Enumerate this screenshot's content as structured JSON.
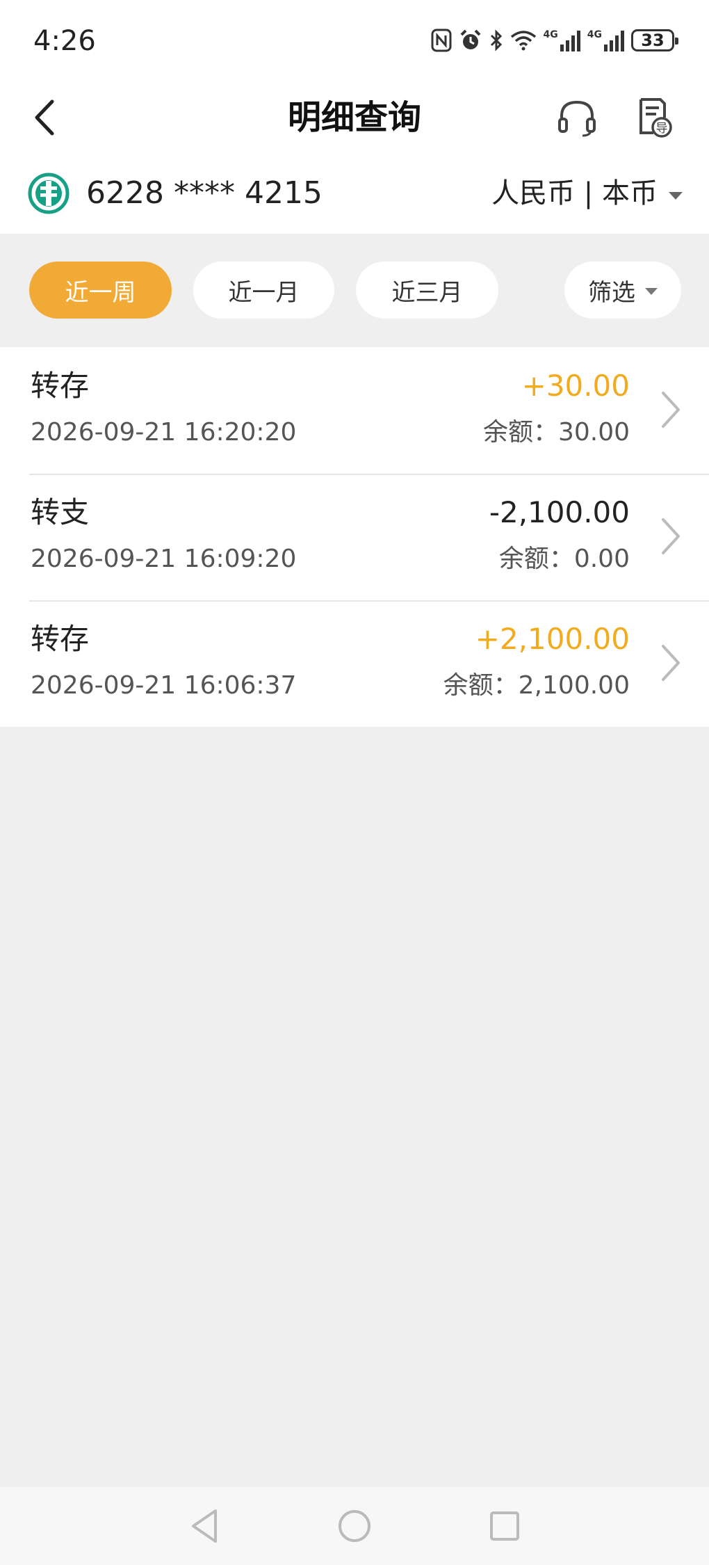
{
  "status_bar": {
    "time": "4:26",
    "signal_label_1": "4G",
    "signal_label_2": "4G",
    "battery": "33",
    "icons": [
      "nfc-icon",
      "alarm-icon",
      "bluetooth-icon",
      "wifi-icon",
      "signal-4g-icon",
      "signal-4g-icon",
      "battery-icon"
    ]
  },
  "header": {
    "title": "明细查询",
    "back_icon": "chevron-left-icon",
    "service_icon": "headset-icon",
    "export_icon": "export-document-icon",
    "export_badge": "导"
  },
  "account": {
    "number": "6228 **** 4215",
    "currency": "人民币 | 本币",
    "logo": "bank-logo"
  },
  "filters": {
    "chips": [
      "近一周",
      "近一月",
      "近三月"
    ],
    "active_index": 0,
    "filter_label": "筛选"
  },
  "transactions": [
    {
      "type": "转存",
      "time": "2026-09-21 16:20:20",
      "amount": "+30.00",
      "balance": "余额：30.00"
    },
    {
      "type": "转支",
      "time": "2026-09-21 16:09:20",
      "amount": "-2,100.00",
      "balance": "余额：0.00"
    },
    {
      "type": "转存",
      "time": "2026-09-21 16:06:37",
      "amount": "+2,100.00",
      "balance": "余额：2,100.00"
    }
  ],
  "colors": {
    "accent": "#f2aa37",
    "positive_amount": "#f2aa1f",
    "logo_green": "#16a085",
    "background": "#efefef"
  }
}
